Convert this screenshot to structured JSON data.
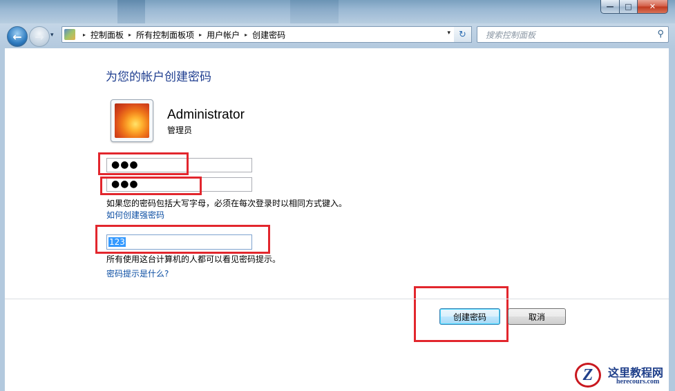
{
  "window": {
    "caption_buttons": {
      "minimize": "—",
      "maximize": "□",
      "close": "✕"
    }
  },
  "nav": {
    "back_icon": "←",
    "forward_icon": "→",
    "dropdown_icon": "▾"
  },
  "address": {
    "breadcrumbs": [
      "控制面板",
      "所有控制面板项",
      "用户帐户",
      "创建密码"
    ],
    "separator": "▸",
    "dropdown_icon": "▾",
    "refresh_icon": "↻"
  },
  "search": {
    "placeholder": "搜索控制面板",
    "icon": "⚲"
  },
  "page": {
    "heading": "为您的帐户创建密码",
    "account": {
      "username": "Administrator",
      "role": "管理员"
    },
    "new_password": "●●●",
    "confirm_password": "●●●",
    "case_note": "如果您的密码包括大写字母，必须在每次登录时以相同方式键入。",
    "strong_password_link": "如何创建强密码",
    "hint_value": "123",
    "hint_note": "所有使用这台计算机的人都可以看见密码提示。",
    "hint_help_link": "密码提示是什么?"
  },
  "buttons": {
    "create": "创建密码",
    "cancel": "取消"
  },
  "watermark": {
    "logo_letter": "Z",
    "title": "这里教程网",
    "url": "herecours.com"
  },
  "colors": {
    "heading": "#1e3d8f",
    "link": "#0d4fa3",
    "highlight_box": "#e2262d",
    "selection": "#3399ff"
  }
}
